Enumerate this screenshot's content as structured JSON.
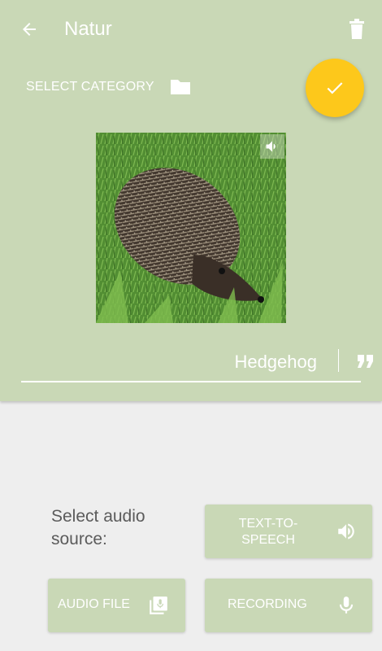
{
  "header": {
    "title": "Natur",
    "back_icon": "arrow-left-icon",
    "delete_icon": "trash-icon"
  },
  "category": {
    "label": "SELECT CATEGORY",
    "icon": "folder-icon"
  },
  "confirm": {
    "icon": "check-icon",
    "color": "#fdc81b"
  },
  "picture": {
    "overlay_icon": "speaker-icon"
  },
  "name_field": {
    "value": "Hedgehog",
    "icon": "quote-icon"
  },
  "audio_source": {
    "label": "Select audio source:",
    "buttons": [
      {
        "label": "TEXT-TO-SPEECH",
        "icon": "speaker-icon"
      },
      {
        "label": "AUDIO FILE",
        "icon": "audio-library-icon"
      },
      {
        "label": "RECORDING",
        "icon": "microphone-icon"
      }
    ]
  },
  "colors": {
    "panel": "#c9d8b6",
    "background": "#eeeeee",
    "accent": "#fdc81b",
    "text_dark": "#5b5b5b"
  }
}
